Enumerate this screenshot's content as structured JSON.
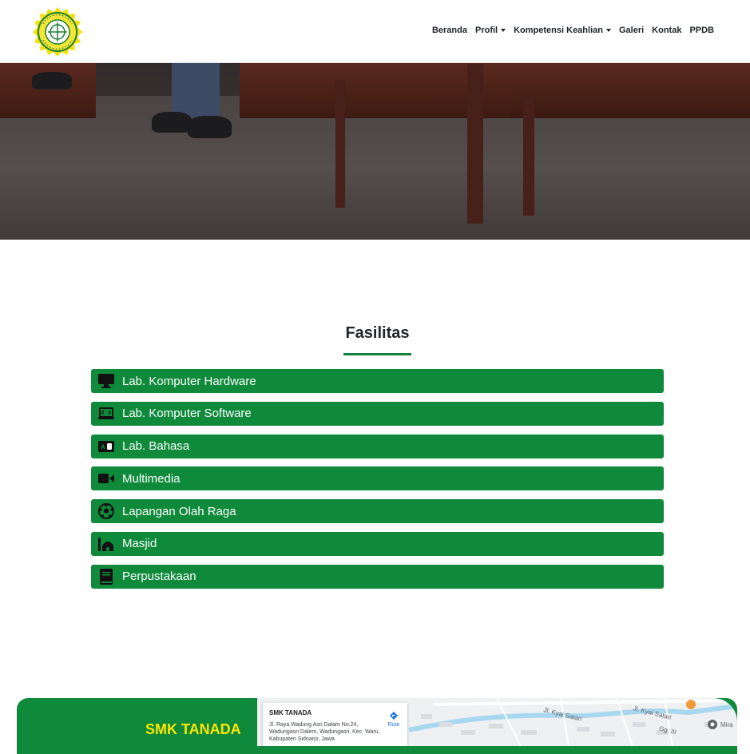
{
  "brand": {
    "logo_alt": "Logo SMK Tanada"
  },
  "nav": {
    "items": [
      {
        "label": "Beranda",
        "dropdown": false
      },
      {
        "label": "Profil",
        "dropdown": true
      },
      {
        "label": "Kompetensi Keahlian",
        "dropdown": true
      },
      {
        "label": "Galeri",
        "dropdown": false
      },
      {
        "label": "Kontak",
        "dropdown": false
      },
      {
        "label": "PPDB",
        "dropdown": false
      }
    ]
  },
  "facilities": {
    "title": "Fasilitas",
    "items": [
      {
        "label": "Lab. Komputer Hardware",
        "icon": "desktop-icon"
      },
      {
        "label": "Lab. Komputer Software",
        "icon": "laptop-code-icon"
      },
      {
        "label": "Lab. Bahasa",
        "icon": "language-icon"
      },
      {
        "label": "Multimedia",
        "icon": "video-camera-icon"
      },
      {
        "label": "Lapangan Olah Raga",
        "icon": "soccer-ball-icon"
      },
      {
        "label": "Masjid",
        "icon": "mosque-icon"
      },
      {
        "label": "Perpustakaan",
        "icon": "book-icon"
      }
    ]
  },
  "footer": {
    "school_name": "SMK TANADA",
    "map": {
      "place_name": "SMK TANADA",
      "address": "Jl. Raya Wadung Asri Dalam No.24, Wadungasri Dalem, Wadungasri, Kec. Waru, Kabupaten Sidoarjo, Jawa",
      "route_label": "Rute",
      "road_1": "Jl. Kyai Satari",
      "road_2": "Jl. Kyai Satari",
      "road_3": "Gg. III",
      "place_2": "Mira"
    }
  },
  "colors": {
    "accent_green": "#0e8a3a",
    "footer_title_yellow": "#ffe600",
    "nav_text": "#1f2326"
  }
}
